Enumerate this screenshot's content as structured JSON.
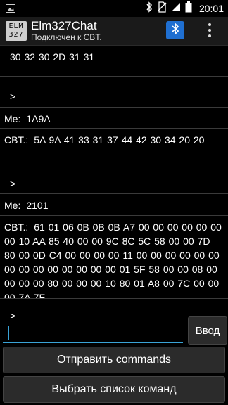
{
  "statusbar": {
    "time": "20:01"
  },
  "appbar": {
    "logo_line1": "ELM",
    "logo_line2": "327",
    "title": "Elm327Chat",
    "subtitle": "Подключен к CBT."
  },
  "messages": [
    {
      "who": "",
      "text": "30 32 30 2D 31 31"
    },
    {
      "who": "",
      "text": ">"
    },
    {
      "who": "Me:",
      "text": "1A9A"
    },
    {
      "who": "CBT.:",
      "text": "5A 9A 41 33 31 37 44 42 30 34 20 20"
    },
    {
      "who": "",
      "text": ">"
    },
    {
      "who": "Me:",
      "text": "2101"
    },
    {
      "who": "CBT.:",
      "text": "61 01 06 0B 0B 0B A7 00 00 00 00 00 00 00 10 AA 85 40 00 00 9C 8C 5C 58 00 00 7D 80 00 0D C4 00 00 00 00 11 00 00 00 00 00 00 00 00 00 00 00 00 00 00 01 5F 58 00 00 08 00 00 00 00 80 00 00 00 10 80 01 A8 00 7C 00 00 00 7A 7F"
    },
    {
      "who": "",
      "text": ">"
    }
  ],
  "input": {
    "value": "",
    "placeholder": ""
  },
  "buttons": {
    "enter": "Ввод",
    "send_commands": "Отправить commands",
    "choose_list": "Выбрать список команд"
  }
}
